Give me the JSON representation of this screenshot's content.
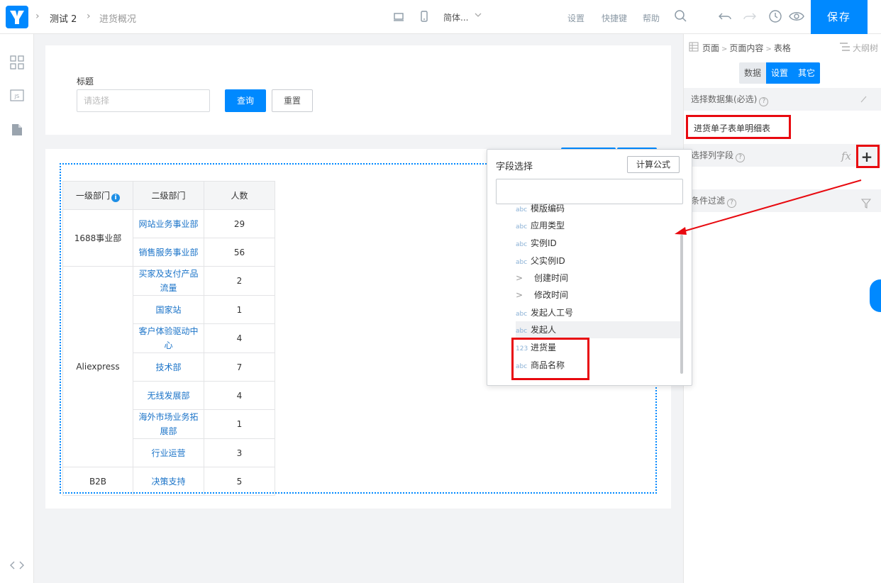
{
  "topbar": {
    "app_name": "测试 2",
    "page_name": "进货概况",
    "language": "简体...",
    "links": [
      "设置",
      "快捷键",
      "帮助"
    ],
    "save_label": "保存"
  },
  "form": {
    "field_label": "标题",
    "field_placeholder": "请选择",
    "query_label": "查询",
    "reset_label": "重置"
  },
  "table": {
    "headers": [
      "一级部门",
      "二级部门",
      "人数"
    ],
    "info_glyph": "i",
    "rows": [
      {
        "dept1": "1688事业部",
        "dept2": "网站业务事业部",
        "count": "29"
      },
      {
        "dept1": "",
        "dept2": "销售服务事业部",
        "count": "56"
      },
      {
        "dept1": "Aliexpress",
        "dept2": "买家及支付产品流量",
        "count": "2"
      },
      {
        "dept1": "",
        "dept2": "国家站",
        "count": "1"
      },
      {
        "dept1": "",
        "dept2": "客户体验驱动中心",
        "count": "4"
      },
      {
        "dept1": "",
        "dept2": "技术部",
        "count": "7"
      },
      {
        "dept1": "",
        "dept2": "无线发展部",
        "count": "4"
      },
      {
        "dept1": "",
        "dept2": "海外市场业务拓展部",
        "count": "1"
      },
      {
        "dept1": "",
        "dept2": "行业运营",
        "count": "3"
      },
      {
        "dept1": "B2B",
        "dept2": "决策支持",
        "count": "5"
      }
    ]
  },
  "right_panel": {
    "breadcrumb": [
      "页面",
      "页面内容",
      "表格"
    ],
    "outline_label": "大纲树",
    "tabs": [
      "数据",
      "设置",
      "其它"
    ],
    "dataset_section": "选择数据集(必选)",
    "dataset_value": "进货单子表单明细表",
    "columns_section": "选择列字段",
    "fx_label": "fx",
    "plus_label": "+",
    "filter_section": "条件过滤",
    "help_glyph": "?"
  },
  "popup": {
    "title": "字段选择",
    "calc_label": "计算公式",
    "search_value": "",
    "fields": [
      {
        "type": "abc",
        "label": "模版编码"
      },
      {
        "type": "abc",
        "label": "应用类型"
      },
      {
        "type": "abc",
        "label": "实例ID"
      },
      {
        "type": "abc",
        "label": "父实例ID"
      },
      {
        "type": ">",
        "label": "创建时间"
      },
      {
        "type": ">",
        "label": "修改时间"
      },
      {
        "type": "abc",
        "label": "发起人工号"
      },
      {
        "type": "abc",
        "label": "发起人"
      },
      {
        "type": "123",
        "label": "进货量"
      },
      {
        "type": "abc",
        "label": "商品名称"
      }
    ]
  },
  "colors": {
    "primary": "#0089ff",
    "highlight": "#e8090f",
    "link": "#1a73c8"
  }
}
